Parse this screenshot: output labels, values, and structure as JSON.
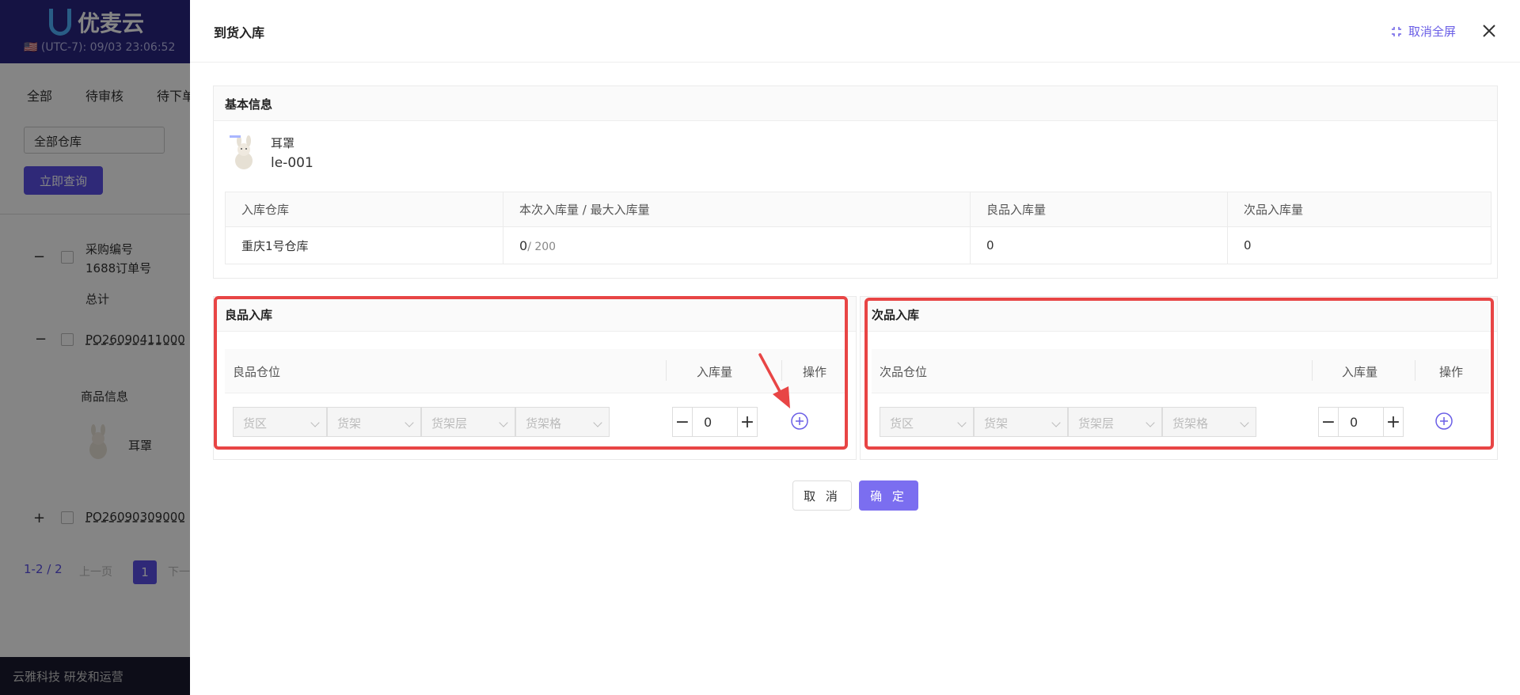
{
  "background": {
    "brand": "优麦云",
    "time": "🇺🇸 (UTC-7): 09/03 23:06:52",
    "tabs": [
      "全部",
      "待审核",
      "待下单"
    ],
    "warehouse_filter": "全部仓库",
    "query_button": "立即查询",
    "col_purchase_no": "采购编号",
    "col_1688_no": "1688订单号",
    "total": "总计",
    "order1": "PO26090411000",
    "product_info": "商品信息",
    "product_name": "耳罩",
    "order2": "PO26090309000",
    "pagination_range": "1-2 / 2",
    "prev_page": "上一页",
    "page_num": "1",
    "next_page": "下一",
    "footer": "云雅科技 研发和运营"
  },
  "drawer": {
    "title": "到货入库",
    "exit_fullscreen": "取消全屏"
  },
  "basic_info": {
    "title": "基本信息",
    "product_name": "耳罩",
    "sku": "le-001",
    "headers": [
      "入库仓库",
      "本次入库量 / 最大入库量",
      "良品入库量",
      "次品入库量"
    ],
    "warehouse": "重庆1号仓库",
    "current_qty": "0",
    "max_qty": "/ 200",
    "good_qty": "0",
    "defect_qty": "0"
  },
  "good_section": {
    "title": "良品入库",
    "col_location": "良品仓位",
    "col_qty": "入库量",
    "col_action": "操作",
    "zone_placeholder": "货区",
    "shelf_placeholder": "货架",
    "layer_placeholder": "货架层",
    "cell_placeholder": "货架格",
    "qty_value": "0"
  },
  "defect_section": {
    "title": "次品入库",
    "col_location": "次品仓位",
    "col_qty": "入库量",
    "col_action": "操作",
    "zone_placeholder": "货区",
    "shelf_placeholder": "货架",
    "layer_placeholder": "货架层",
    "cell_placeholder": "货架格",
    "qty_value": "0"
  },
  "footer_buttons": {
    "cancel": "取 消",
    "confirm": "确 定"
  },
  "colors": {
    "accent": "#7b6ef0",
    "highlight": "#e84545",
    "brand_dark": "#2a2580"
  }
}
